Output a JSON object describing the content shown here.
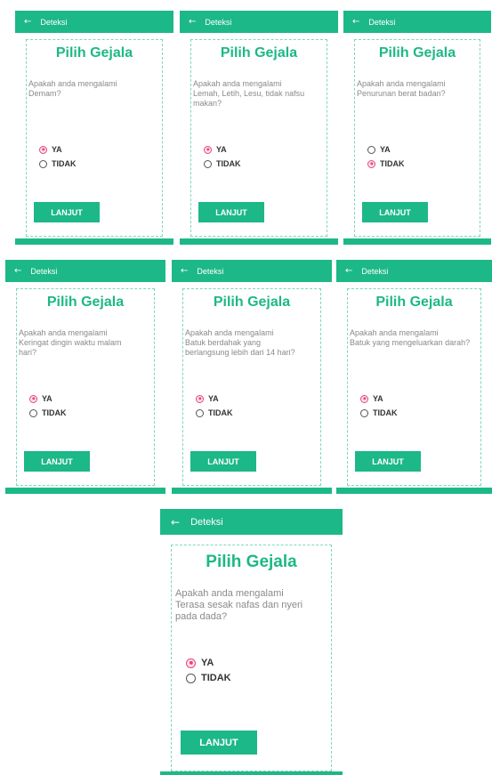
{
  "app": {
    "title": "Deteksi",
    "back_icon": "←",
    "card_title": "Pilih Gejala",
    "yes_label": "YA",
    "no_label": "TIDAK",
    "next_label": "LANJUT"
  },
  "colors": {
    "accent": "#1db887",
    "selected_radio": "#e8457f"
  },
  "screens": [
    {
      "question": "Apakah anda mengalami\nDemam?",
      "selected": "YA"
    },
    {
      "question": "Apakah anda mengalami\nLemah, Letih, Lesu, tidak nafsu\nmakan?",
      "selected": "YA"
    },
    {
      "question": "Apakah anda mengalami\nPenurunan berat badan?",
      "selected": "TIDAK"
    },
    {
      "question": "Apakah anda mengalami\nKeringat dingin waktu malam\nhari?",
      "selected": "YA"
    },
    {
      "question": "Apakah anda mengalami\nBatuk berdahak yang\nberlangsung lebih dari 14 hari?",
      "selected": "YA"
    },
    {
      "question": "Apakah anda mengalami\nBatuk yang mengeluarkan darah?",
      "selected": "YA"
    },
    {
      "question": "Apakah anda mengalami\nTerasa sesak nafas dan nyeri\npada dada?",
      "selected": "YA"
    }
  ]
}
